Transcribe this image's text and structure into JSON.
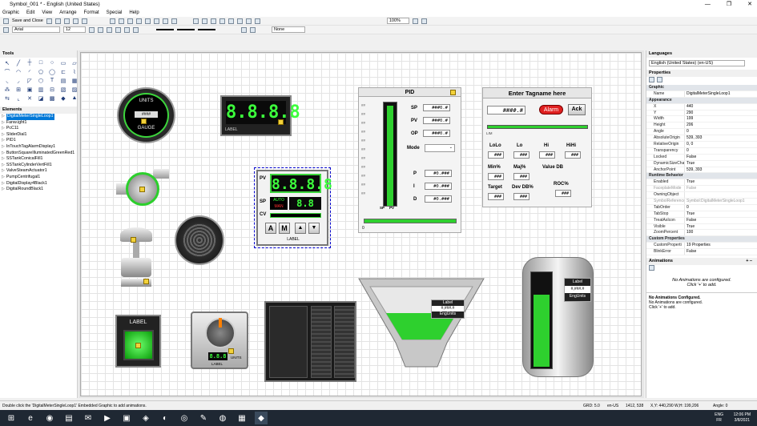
{
  "window": {
    "title": "Symbol_001 * - English (United States)",
    "controls": [
      "—",
      "❐",
      "✕"
    ]
  },
  "menu": [
    "Graphic",
    "Edit",
    "View",
    "Arrange",
    "Format",
    "Special",
    "Help"
  ],
  "toolbar": {
    "save_close": "Save and Close",
    "font": "Arial",
    "font_size": "12",
    "zoom": "100%",
    "line_style": "None"
  },
  "left": {
    "tools_title": "Tools",
    "tools": [
      "↖",
      "╱",
      "┼",
      "□",
      "○",
      "▭",
      "▱",
      "⌒",
      "◠",
      "◜",
      "⬠",
      "◯",
      "⊏",
      "⌇",
      "◟",
      "◞",
      "◸",
      "⬡",
      "T",
      "▤",
      "▦",
      "⁂",
      "⊞",
      "▣",
      "▥",
      "⊟",
      "▧",
      "▨",
      "⇆",
      "⌞",
      "✕",
      "◪",
      "▩",
      "◆",
      "▲"
    ],
    "elements_title": "Elements",
    "elements": [
      "DigitalMeterSingleLoop1",
      "Fanw.ight1",
      "PcC11",
      "SliderDial1",
      "PID1",
      "InTouchTagAlarmDisplay1",
      "ButtonSquareIlluminatedGreenRed1",
      "SSTankConicalFill1",
      "SSTankCylinderVertFill1",
      "ValveSteamActuator1",
      "PumpCentrifugal1",
      "DigitalDisplay4Black1",
      "DigitalRoundBlack1"
    ]
  },
  "canvas": {
    "gauge": {
      "units": "UNITS",
      "value": "####",
      "label": "GAUGE"
    },
    "digital_display": {
      "value": "8.8.8.8",
      "label": "LABEL"
    },
    "loop": {
      "pv": "PV",
      "sp": "SP",
      "cv": "CV",
      "auto": "AUTO",
      "man": "MAN",
      "a": "A",
      "m": "M",
      "label": "LABEL",
      "value": "8.8.8.8",
      "small": "8.8"
    },
    "pid": {
      "title": "PID",
      "sp": "SP",
      "pv": "PV",
      "op": "OP",
      "mode": "Mode",
      "p": "P",
      "i": "I",
      "d": "D",
      "val": "###0.#",
      "val2": "#0.###",
      "scale": "##",
      "sp_mark": "SP",
      "pv_mark": "PV",
      "zero": "0"
    },
    "alarm": {
      "title": "Enter Tagname here",
      "value": "####.#",
      "alarm": "Alarm",
      "ack": "Ack",
      "lolo": "LoLo",
      "lo": "Lo",
      "hi": "Hi",
      "hihi": "HiHi",
      "minpct": "Min%",
      "majpct": "Maj%",
      "valuedb": "Value DB",
      "target": "Target",
      "devdb": "Dev DB%",
      "roc": "ROC%",
      "lim": "LIM",
      "num": "###",
      "hash": "##"
    },
    "button_sq": {
      "label": "LABEL"
    },
    "knob": {
      "label": "LABEL",
      "units": "UNITS",
      "value": "8.8.8"
    },
    "conical": {
      "label": "Label",
      "value": "#,###.#",
      "units": "EngUnits",
      "scale": "##"
    },
    "cylinder": {
      "label": "Label",
      "value": "#,###.#",
      "units": "EngUnits",
      "scale": "##"
    }
  },
  "right": {
    "languages_title": "Languages",
    "language": "English (United States) (en-US)",
    "properties_title": "Properties",
    "props": [
      {
        "cat": "Graphic"
      },
      {
        "n": "Name",
        "v": "DigitalMeterSingleLoop1"
      },
      {
        "cat": "Appearance"
      },
      {
        "n": "X",
        "v": "440"
      },
      {
        "n": "Y",
        "v": "290"
      },
      {
        "n": "Width",
        "v": "199"
      },
      {
        "n": "Height",
        "v": "206"
      },
      {
        "n": "Angle",
        "v": "0"
      },
      {
        "n": "AbsoluteOrigin",
        "v": "539, 393"
      },
      {
        "n": "RelativeOrigin",
        "v": "0, 0"
      },
      {
        "n": "Transparency",
        "v": "0"
      },
      {
        "n": "Locked",
        "v": "False"
      },
      {
        "n": "DynamicSizeChang",
        "v": "True"
      },
      {
        "n": "AnchorPoint",
        "v": "539, 393"
      },
      {
        "cat": "Runtime Behavior"
      },
      {
        "n": "Enabled",
        "v": "True"
      },
      {
        "n": "FaceplateMode",
        "v": "False",
        "grey": true
      },
      {
        "n": "OwningObject",
        "v": ""
      },
      {
        "n": "SymbolReference",
        "v": "Symbol:DigitalMeterSingleLoop1",
        "grey": true
      },
      {
        "n": "TabOrder",
        "v": "0"
      },
      {
        "n": "TabStop",
        "v": "True"
      },
      {
        "n": "TreatAsIcon",
        "v": "False"
      },
      {
        "n": "Visible",
        "v": "True"
      },
      {
        "n": "ZoomPercent",
        "v": "100"
      },
      {
        "cat": "Custom Properties"
      },
      {
        "n": "CustomProperti",
        "v": "19 Properties"
      },
      {
        "n": "BlinkError",
        "v": "False"
      }
    ],
    "animations_title": "Animations",
    "anim_msg1": "No Animations are configured.",
    "anim_msg2": "Click '+' to add.",
    "anim_msg3": "No Animations Configured.",
    "anim_msg4": "No Animations are configured.",
    "anim_msg5": "Click '+' to add."
  },
  "status": {
    "hint": "Double click the 'DigitalMeterSingleLoop1' Embedded Graphic to add animations.",
    "grid": "GRD: 5.0",
    "lang": "en-US",
    "pos": "1412, 538",
    "xy": "X,Y: 440,290  W,H: 199,206",
    "angle": "Angle: 0"
  },
  "taskbar": {
    "lang": "ENG",
    "kb": "FR",
    "time": "12:06 PM",
    "date": "3/8/2021"
  }
}
